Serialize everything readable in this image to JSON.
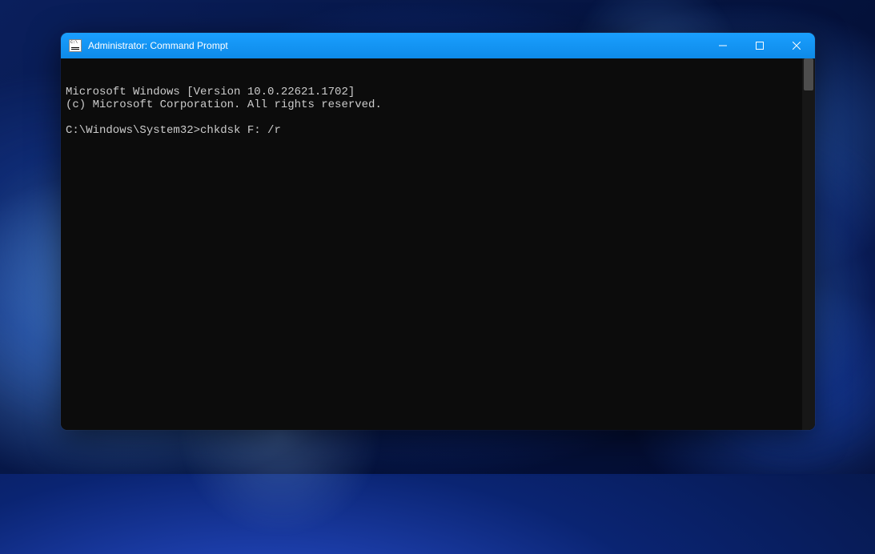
{
  "window": {
    "title": "Administrator: Command Prompt"
  },
  "terminal": {
    "line1": "Microsoft Windows [Version 10.0.22621.1702]",
    "line2": "(c) Microsoft Corporation. All rights reserved.",
    "blank": "",
    "prompt": "C:\\Windows\\System32>",
    "command": "chkdsk F: /r"
  }
}
